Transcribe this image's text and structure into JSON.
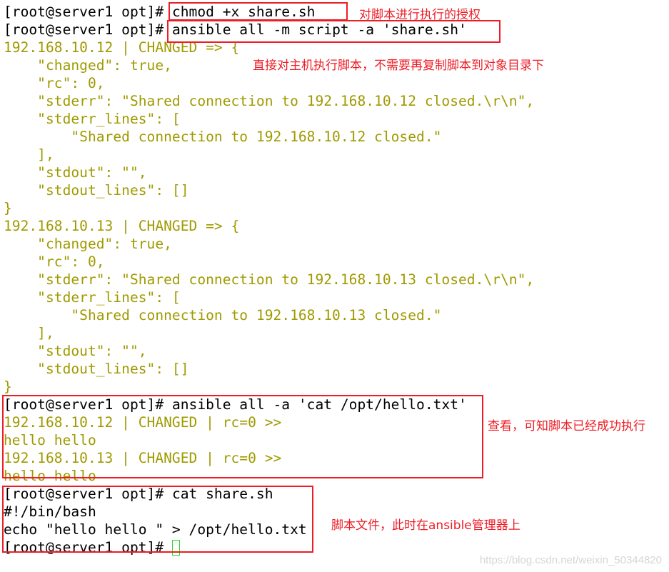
{
  "terminal": {
    "prompt": "[root@server1 opt]# ",
    "lines": [
      {
        "type": "cmd",
        "prompt": "[root@server1 opt]# ",
        "text": "chmod +x share.sh"
      },
      {
        "type": "cmd",
        "prompt": "[root@server1 opt]# ",
        "text": "ansible all -m script -a 'share.sh'"
      },
      {
        "type": "out",
        "text": "192.168.10.12 | CHANGED => {"
      },
      {
        "type": "out",
        "text": "    \"changed\": true,"
      },
      {
        "type": "out",
        "text": "    \"rc\": 0,"
      },
      {
        "type": "out",
        "text": "    \"stderr\": \"Shared connection to 192.168.10.12 closed.\\r\\n\","
      },
      {
        "type": "out",
        "text": "    \"stderr_lines\": ["
      },
      {
        "type": "out",
        "text": "        \"Shared connection to 192.168.10.12 closed.\""
      },
      {
        "type": "out",
        "text": "    ],"
      },
      {
        "type": "out",
        "text": "    \"stdout\": \"\","
      },
      {
        "type": "out",
        "text": "    \"stdout_lines\": []"
      },
      {
        "type": "out",
        "text": "}"
      },
      {
        "type": "out",
        "text": "192.168.10.13 | CHANGED => {"
      },
      {
        "type": "out",
        "text": "    \"changed\": true,"
      },
      {
        "type": "out",
        "text": "    \"rc\": 0,"
      },
      {
        "type": "out",
        "text": "    \"stderr\": \"Shared connection to 192.168.10.13 closed.\\r\\n\","
      },
      {
        "type": "out",
        "text": "    \"stderr_lines\": ["
      },
      {
        "type": "out",
        "text": "        \"Shared connection to 192.168.10.13 closed.\""
      },
      {
        "type": "out",
        "text": "    ],"
      },
      {
        "type": "out",
        "text": "    \"stdout\": \"\","
      },
      {
        "type": "out",
        "text": "    \"stdout_lines\": []"
      },
      {
        "type": "out",
        "text": "}"
      },
      {
        "type": "cmd",
        "prompt": "[root@server1 opt]# ",
        "text": "ansible all -a 'cat /opt/hello.txt'"
      },
      {
        "type": "out",
        "text": "192.168.10.12 | CHANGED | rc=0 >>"
      },
      {
        "type": "out",
        "text": "hello hello"
      },
      {
        "type": "out",
        "text": "192.168.10.13 | CHANGED | rc=0 >>"
      },
      {
        "type": "out",
        "text": "hello hello"
      },
      {
        "type": "cmd",
        "prompt": "[root@server1 opt]# ",
        "text": "cat share.sh"
      },
      {
        "type": "cmd",
        "prompt": "",
        "text": "#!/bin/bash"
      },
      {
        "type": "cmd",
        "prompt": "",
        "text": "echo \"hello hello \" > /opt/hello.txt"
      },
      {
        "type": "cmd",
        "prompt": "[root@server1 opt]# ",
        "text": "",
        "cursor": true
      }
    ]
  },
  "annotations": {
    "chmod_note": "对脚本进行执行的授权",
    "script_note": "直接对主机执行脚本，不需要再复制脚本到对象目录下",
    "check_note": "查看，可知脚本已经成功执行",
    "file_note": "脚本文件，此时在ansible管理器上"
  },
  "watermark": "https://blog.csdn.net/weixin_50344820",
  "colors": {
    "command": "#000000",
    "output": "#a09a00",
    "annotation": "#ee1c25",
    "cursor": "#22dd22"
  }
}
